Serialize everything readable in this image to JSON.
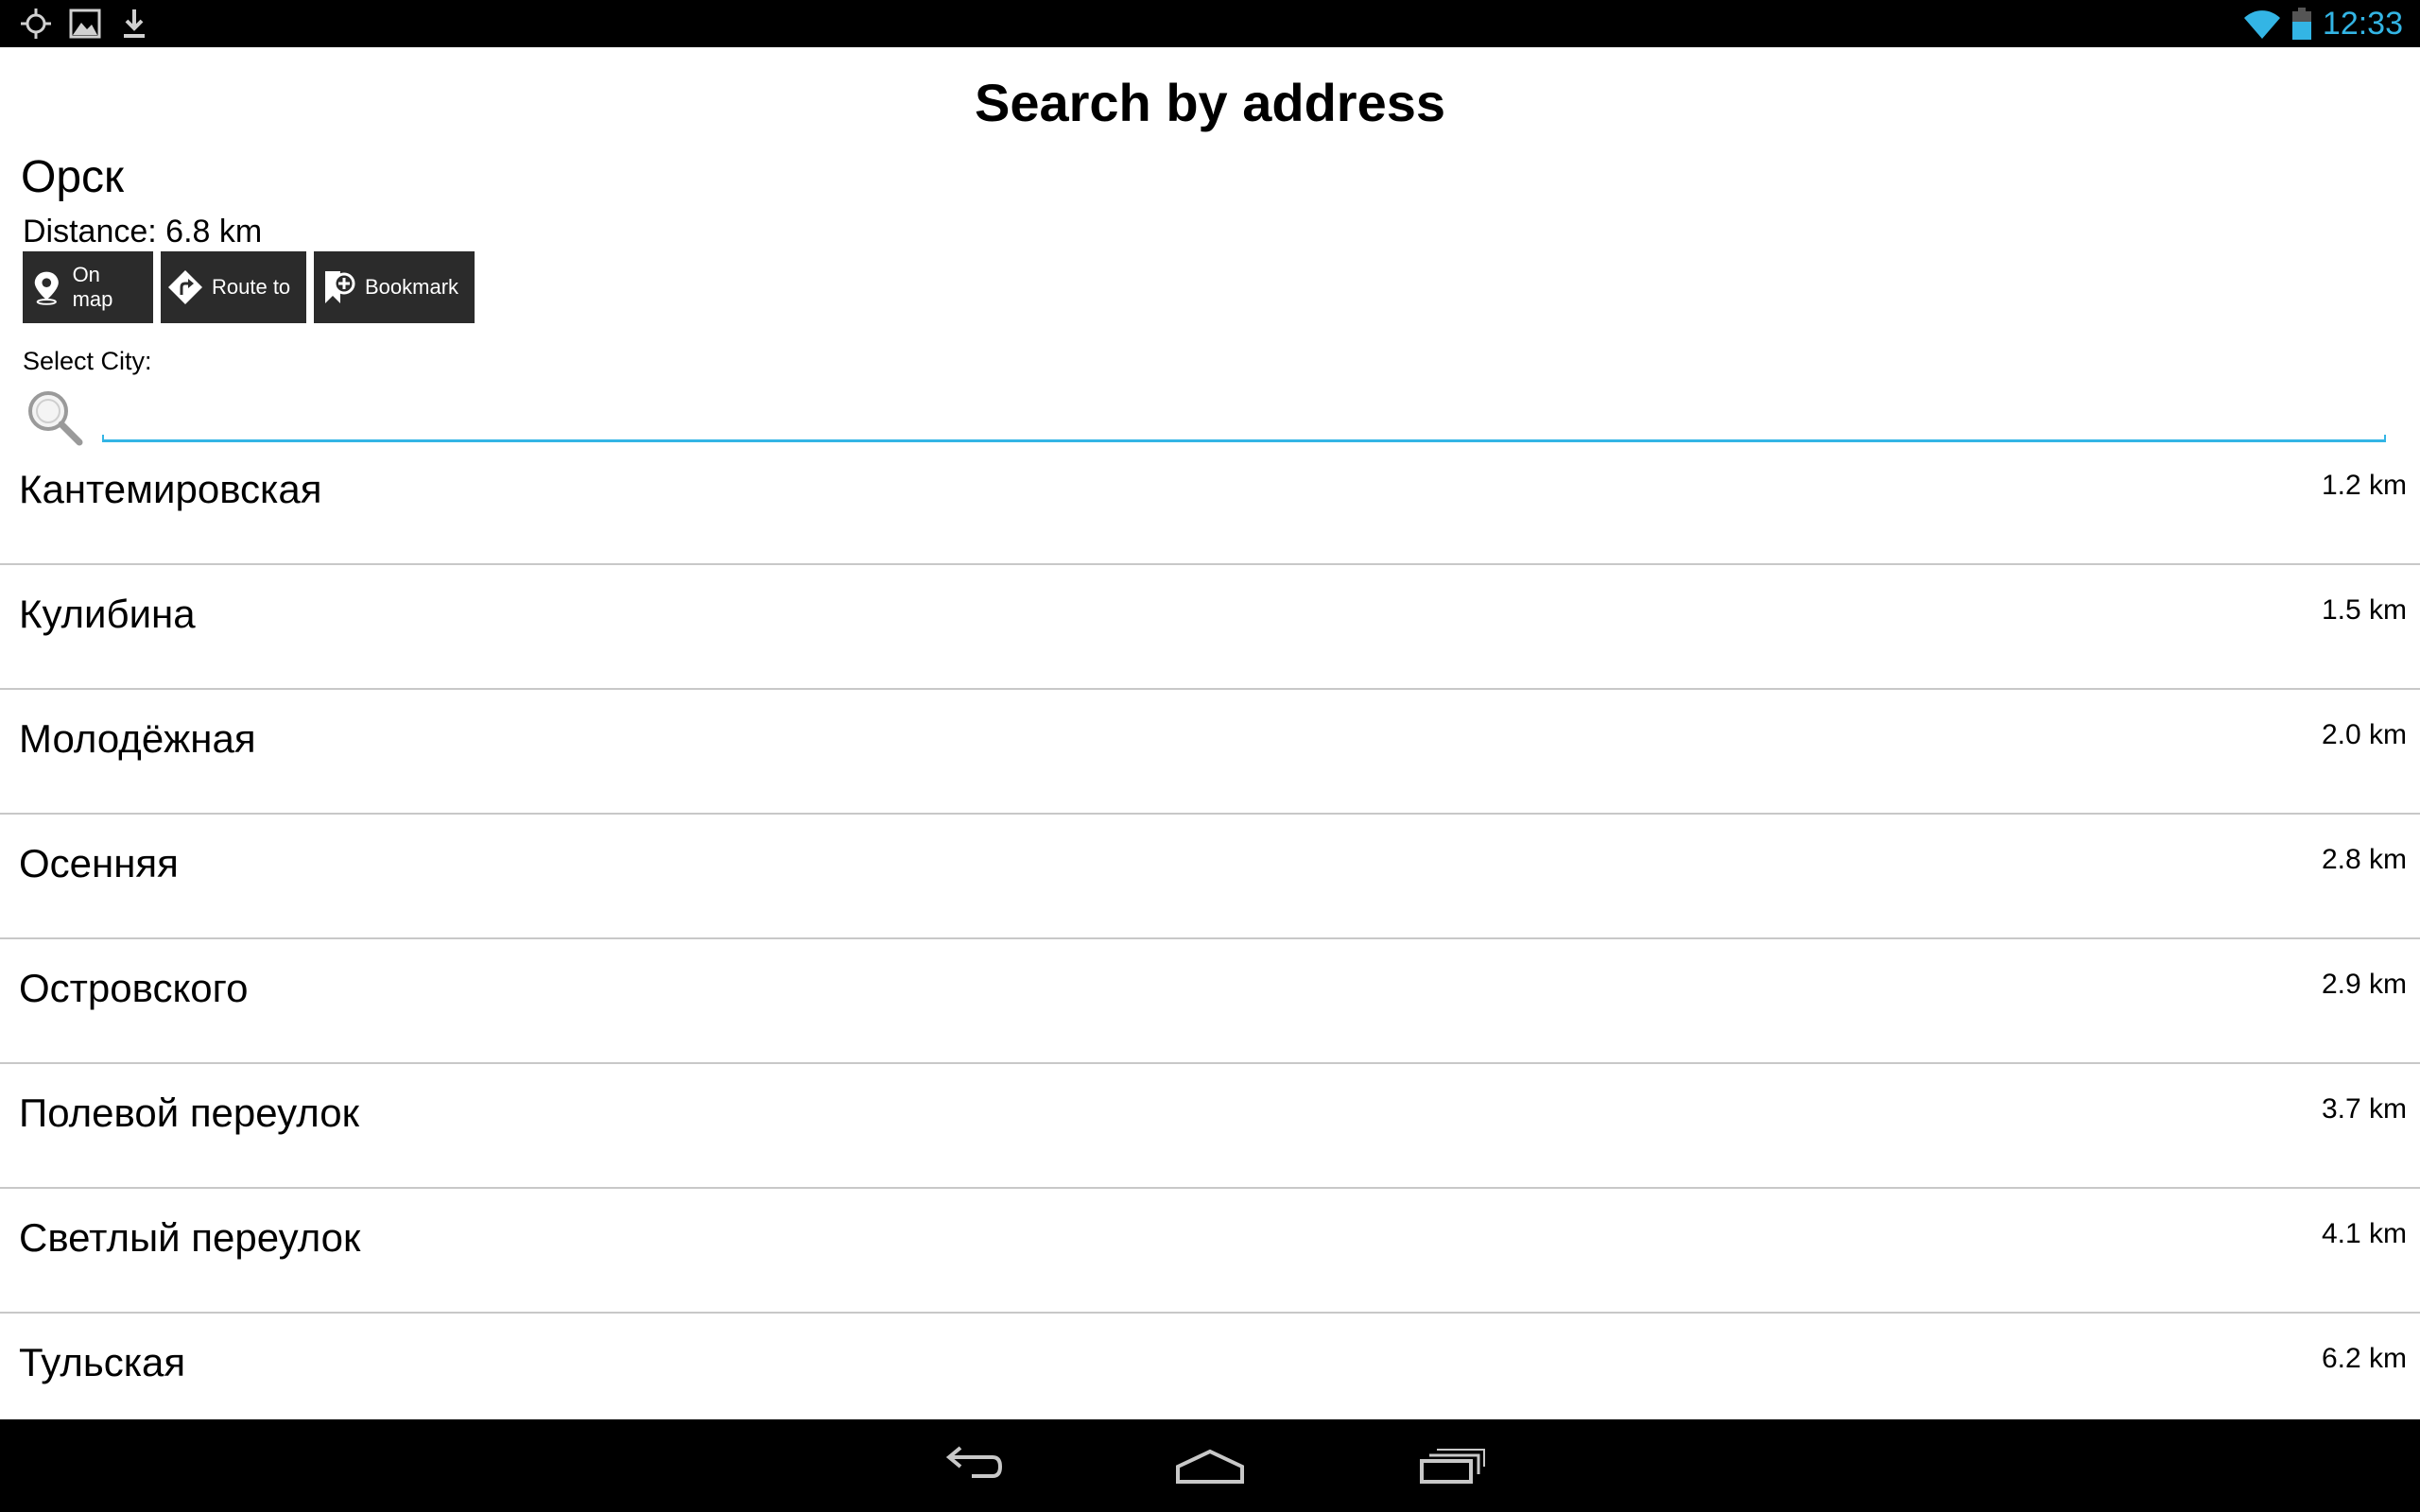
{
  "status_bar": {
    "time": "12:33",
    "accent_color": "#33b5e5",
    "left_icons": [
      "gps-icon",
      "image-icon",
      "download-icon"
    ],
    "right_icons": [
      "wifi-icon",
      "battery-icon"
    ]
  },
  "header": {
    "title": "Search by address"
  },
  "location": {
    "city": "Орск",
    "distance": "Distance: 6.8 km"
  },
  "actions": [
    {
      "label": "On map",
      "icon": "map-pin-icon"
    },
    {
      "label": "Route to",
      "icon": "route-icon"
    },
    {
      "label": "Bookmark",
      "icon": "bookmark-add-icon"
    }
  ],
  "search": {
    "label": "Select City:",
    "value": "",
    "placeholder": ""
  },
  "streets": [
    {
      "name": "Кантемировская",
      "distance": "1.2 km"
    },
    {
      "name": "Кулибина",
      "distance": "1.5 km"
    },
    {
      "name": "Молодёжная",
      "distance": "2.0 km"
    },
    {
      "name": "Осенняя",
      "distance": "2.8 km"
    },
    {
      "name": "Островского",
      "distance": "2.9 km"
    },
    {
      "name": "Полевой переулок",
      "distance": "3.7 km"
    },
    {
      "name": "Светлый переулок",
      "distance": "4.1 km"
    },
    {
      "name": "Тульская",
      "distance": "6.2 km"
    }
  ],
  "nav_bar": [
    "back-icon",
    "home-icon",
    "recent-apps-icon"
  ]
}
